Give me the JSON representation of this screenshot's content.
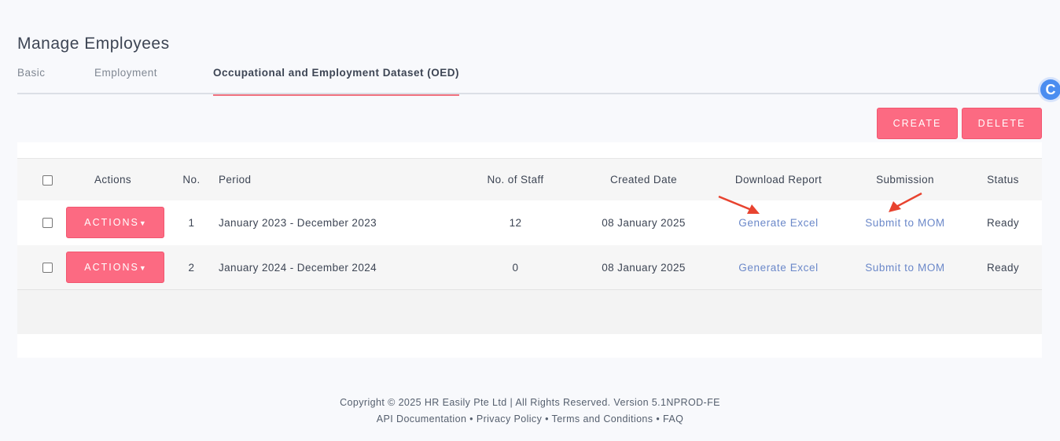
{
  "page_title": "Manage Employees",
  "tabs": [
    {
      "label": "Basic"
    },
    {
      "label": "Employment"
    },
    {
      "label": "Occupational and Employment Dataset (OED)"
    }
  ],
  "active_tab": "Occupational and Employment Dataset (OED)",
  "toolbar": {
    "create_label": "CREATE",
    "delete_label": "DELETE"
  },
  "table": {
    "headers": {
      "actions": "Actions",
      "no": "No.",
      "period": "Period",
      "staff": "No. of Staff",
      "created": "Created Date",
      "download": "Download Report",
      "submission": "Submission",
      "status": "Status"
    },
    "rows": [
      {
        "actions": "ACTIONS",
        "no": "1",
        "period": "January 2023 - December 2023",
        "staff": "12",
        "created": "08 January 2025",
        "download": "Generate Excel",
        "submission": "Submit to MOM",
        "status": "Ready"
      },
      {
        "actions": "ACTIONS",
        "no": "2",
        "period": "January 2024 - December 2024",
        "staff": "0",
        "created": "08 January 2025",
        "download": "Generate Excel",
        "submission": "Submit to MOM",
        "status": "Ready"
      }
    ]
  },
  "footer": {
    "copyright": "Copyright © 2025 HR Easily Pte Ltd | All Rights Reserved. Version 5.1NPROD-FE",
    "links": [
      "API Documentation",
      "Privacy Policy",
      "Terms and Conditions",
      "FAQ"
    ]
  },
  "colors": {
    "accent": "#fc6a82",
    "link": "#6b88c9",
    "tab_underline": "#f0727f",
    "annotation_arrow": "#e8432f"
  },
  "icons": [
    "refresh-icon",
    "caret-down-icon",
    "annotation-arrow"
  ]
}
